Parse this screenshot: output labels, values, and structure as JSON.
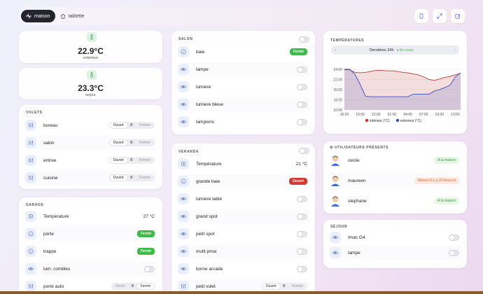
{
  "topbar": {
    "tabs": [
      {
        "label": "maison",
        "active": true
      },
      {
        "label": "tablette",
        "active": false
      }
    ]
  },
  "sensors": [
    {
      "value": "22.9°C",
      "label": "exterieur"
    },
    {
      "value": "23.3°C",
      "label": "sejour"
    }
  ],
  "volets": {
    "title": "VOLETS",
    "rows": [
      {
        "label": "bureau",
        "open": "Ouvert",
        "close": "Fermer",
        "state": "open"
      },
      {
        "label": "salon",
        "open": "Ouvert",
        "close": "Fermer",
        "state": "open"
      },
      {
        "label": "entree",
        "open": "Ouvert",
        "close": "Fermer",
        "state": "open"
      },
      {
        "label": "cuisine",
        "open": "Ouvert",
        "close": "Fermer",
        "state": "open"
      }
    ]
  },
  "garage": {
    "title": "GARAGE",
    "rows": [
      {
        "label": "Température",
        "type": "value",
        "value": "27 °C"
      },
      {
        "label": "porte",
        "type": "badge",
        "value": "Fermé"
      },
      {
        "label": "trappe",
        "type": "badge",
        "value": "Fermé"
      },
      {
        "label": "lum. combles",
        "type": "toggle"
      },
      {
        "label": "porte auto",
        "type": "seg",
        "open": "Ouvrir",
        "close": "Fermé",
        "state": "close"
      }
    ]
  },
  "salon": {
    "title": "SALON",
    "rows": [
      {
        "label": "baie",
        "type": "badge",
        "value": "Fermé"
      },
      {
        "label": "lampe",
        "type": "toggle"
      },
      {
        "label": "lumiere",
        "type": "toggle"
      },
      {
        "label": "lumiere bleue",
        "type": "toggle"
      },
      {
        "label": "lampions",
        "type": "toggle"
      }
    ]
  },
  "veranda": {
    "title": "VERANDA",
    "rows": [
      {
        "label": "Température",
        "type": "value",
        "value": "21 °C"
      },
      {
        "label": "grande baie",
        "type": "badge",
        "value": "Ouvert"
      },
      {
        "label": "lumiere table",
        "type": "toggle"
      },
      {
        "label": "grand spot",
        "type": "toggle"
      },
      {
        "label": "petit spot",
        "type": "toggle"
      },
      {
        "label": "multi prise",
        "type": "toggle"
      },
      {
        "label": "borne arcade",
        "type": "toggle"
      },
      {
        "label": "petit volet",
        "type": "seg",
        "open": "Ouvert",
        "close": "Fermer",
        "state": "open"
      }
    ]
  },
  "temperatures": {
    "title": "TEMPÉRATURES",
    "period": "Dernières 24h",
    "status": "En cours"
  },
  "chart_data": {
    "type": "line",
    "title": "",
    "x": [
      "16:00",
      "17:00",
      "18:00",
      "19:00",
      "20:00",
      "21:00",
      "22:00",
      "23:00",
      "00:00",
      "01:00",
      "02:00",
      "03:00",
      "04:00",
      "05:00",
      "06:00",
      "07:00",
      "08:00",
      "09:00",
      "10:00",
      "11:00",
      "12:00",
      "13:00",
      "14:00"
    ],
    "xticks": [
      "16:00",
      "19:00",
      "22:00",
      "01:00",
      "04:00",
      "07:00",
      "10:00",
      "13:00"
    ],
    "yticks": [
      "16.00",
      "18.00",
      "20.00",
      "22.00",
      "24.00"
    ],
    "ylim": [
      16,
      24
    ],
    "series": [
      {
        "name": "intérieur (°C)",
        "color": "#c0392b",
        "values": [
          23.9,
          23.9,
          23.4,
          23.3,
          23.4,
          23.6,
          23.8,
          23.8,
          23.7,
          23.7,
          23.6,
          23.4,
          23.3,
          23.1,
          22.9,
          22.5,
          22.0,
          21.8,
          22.1,
          22.4,
          22.6,
          22.9,
          23.2
        ]
      },
      {
        "name": "exterieur (°C)",
        "color": "#3b4cc0",
        "values": [
          24.0,
          24.0,
          23.0,
          21.0,
          18.7,
          18.6,
          18.6,
          18.6,
          18.6,
          18.6,
          18.6,
          18.6,
          18.6,
          19.1,
          19.1,
          19.1,
          19.1,
          19.7,
          20.0,
          20.4,
          20.9,
          22.5,
          23.3
        ]
      }
    ],
    "legend": "bottom"
  },
  "users": {
    "title": "UTILISATEURS PRÉSENTS",
    "rows": [
      {
        "label": "cecile",
        "value": "A la maison",
        "tone": "green"
      },
      {
        "label": "maureen",
        "value": "Absent (il y a 20 heures)",
        "tone": "orange"
      },
      {
        "label": "stephane",
        "value": "A la maison",
        "tone": "green"
      }
    ]
  },
  "sejour": {
    "title": "SÉJOUR",
    "rows": [
      {
        "label": "Imac G4",
        "type": "toggle"
      },
      {
        "label": "lampe",
        "type": "toggle"
      }
    ]
  },
  "colors": {
    "accent": "#6a6ff0",
    "green": "#3fb94a",
    "red": "#d63a31"
  }
}
